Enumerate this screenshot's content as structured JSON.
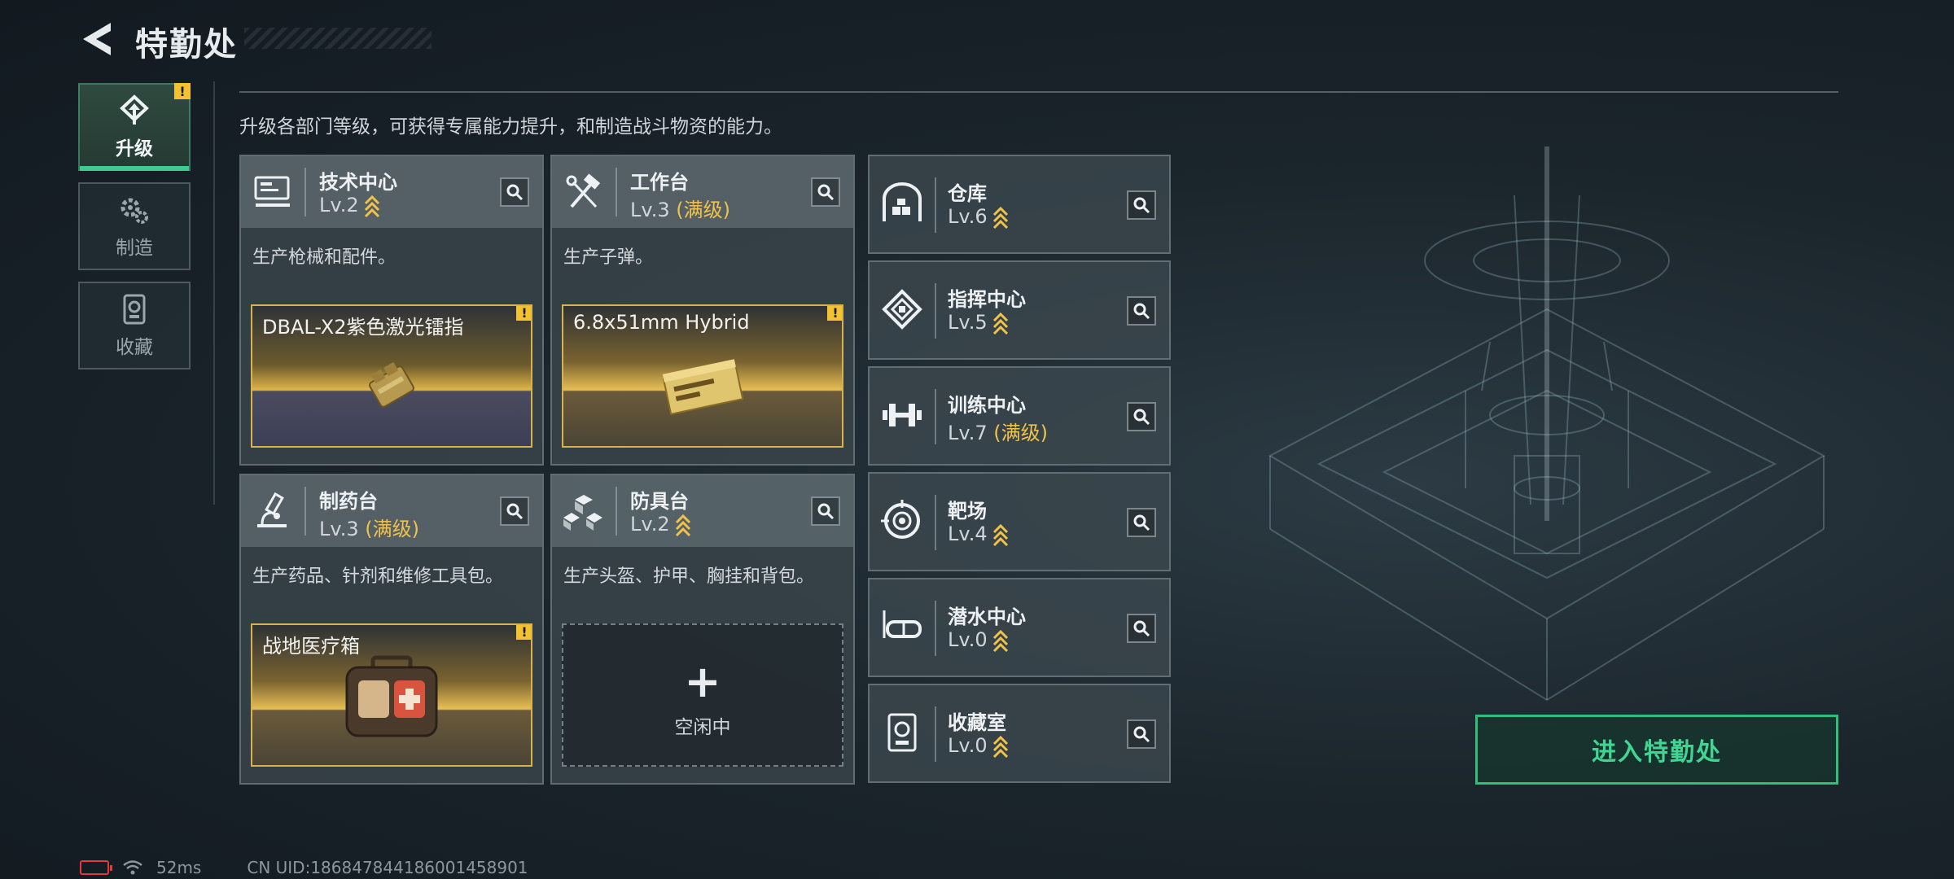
{
  "header": {
    "title": "特勤处",
    "description": "升级各部门等级，可获得专属能力提升，和制造战斗物资的能力。"
  },
  "nav": [
    {
      "label": "升级",
      "icon": "upgrade-icon",
      "active": true,
      "alert": "!"
    },
    {
      "label": "制造",
      "icon": "gears-icon",
      "active": false
    },
    {
      "label": "收藏",
      "icon": "collection-icon",
      "active": false
    }
  ],
  "cards": [
    {
      "name": "技术中心",
      "level": "Lv.2",
      "maxed": "",
      "desc": "生产枪械和配件。",
      "slot_item": "DBAL-X2紫色激光镭指",
      "slot_alert": "!"
    },
    {
      "name": "工作台",
      "level": "Lv.3",
      "maxed": "(满级)",
      "desc": "生产子弹。",
      "slot_item": "6.8x51mm Hybrid",
      "slot_alert": "!"
    },
    {
      "name": "制药台",
      "level": "Lv.3",
      "maxed": "(满级)",
      "desc": "生产药品、针剂和维修工具包。",
      "slot_item": "战地医疗箱",
      "slot_alert": "!"
    },
    {
      "name": "防具台",
      "level": "Lv.2",
      "maxed": "",
      "desc": "生产头盔、护甲、胸挂和背包。",
      "slot_plus": "+",
      "slot_status": "空闲中"
    }
  ],
  "side_cards": [
    {
      "name": "仓库",
      "level": "Lv.6",
      "maxed": "",
      "icon": "warehouse-icon"
    },
    {
      "name": "指挥中心",
      "level": "Lv.5",
      "maxed": "",
      "icon": "command-icon"
    },
    {
      "name": "训练中心",
      "level": "Lv.7",
      "maxed": "(满级)",
      "icon": "dumbbell-icon"
    },
    {
      "name": "靶场",
      "level": "Lv.4",
      "maxed": "",
      "icon": "target-icon"
    },
    {
      "name": "潜水中心",
      "level": "Lv.0",
      "maxed": "",
      "icon": "diving-mask-icon"
    },
    {
      "name": "收藏室",
      "level": "Lv.0",
      "maxed": "",
      "icon": "collection-room-icon"
    }
  ],
  "enter_button": "进入特勤处",
  "footer": {
    "ping": "52ms",
    "uid": "CN UID:186847844186001458901"
  },
  "colors": {
    "accent_green": "#3fc88f",
    "max_gold": "#f0c24a",
    "alert_yellow": "#f2c230",
    "battery_red": "#e23a3a"
  }
}
